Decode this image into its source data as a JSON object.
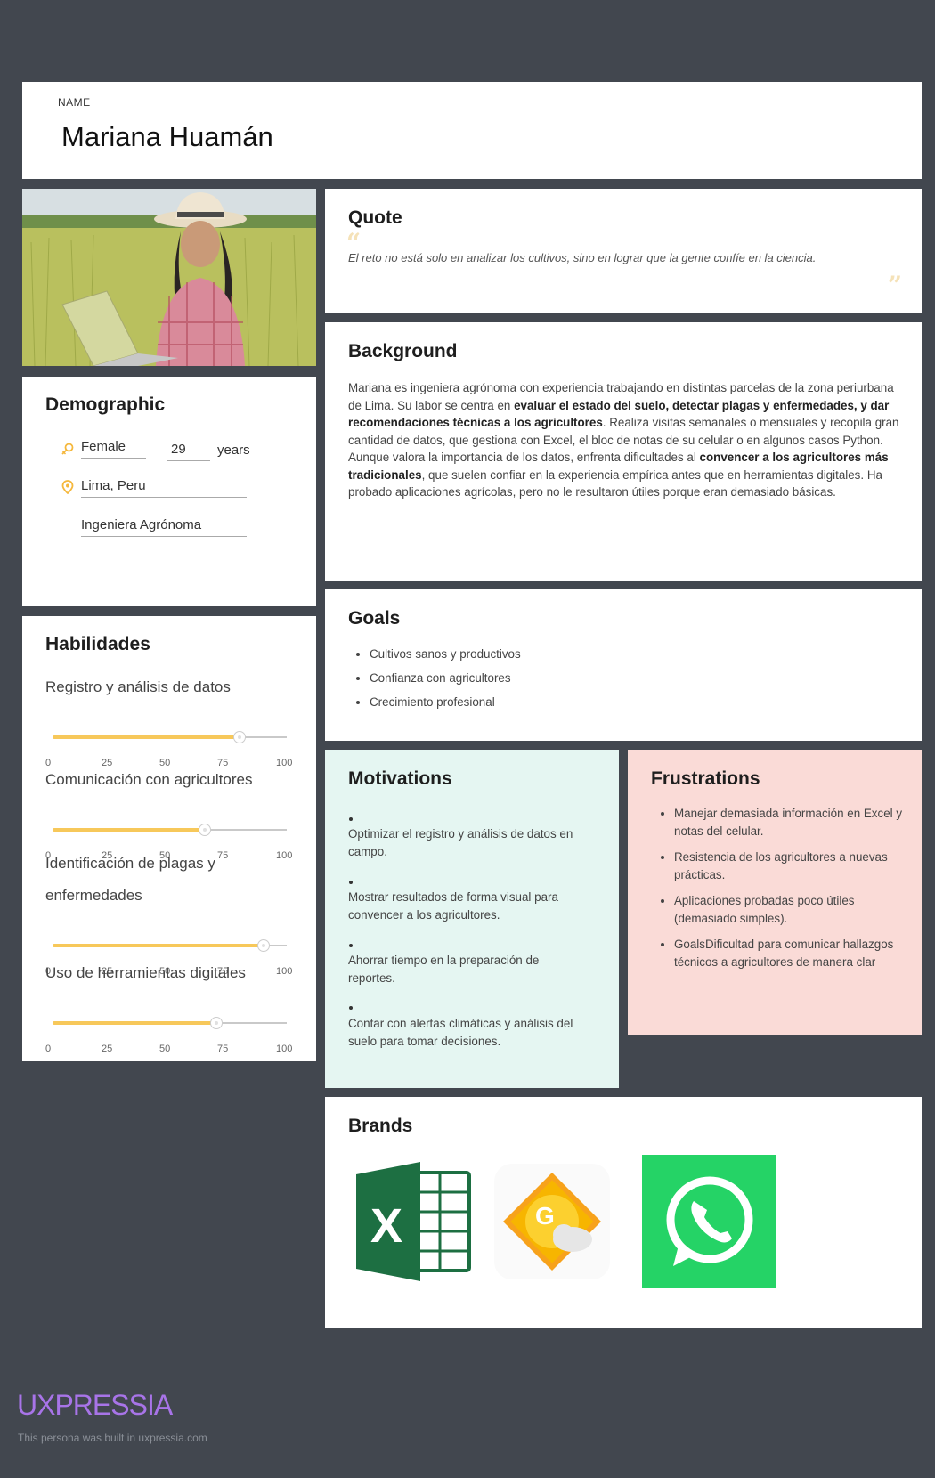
{
  "header": {
    "name_label": "NAME",
    "name": "Mariana Huamán"
  },
  "demographic": {
    "title": "Demographic",
    "gender": "Female",
    "age": "29",
    "age_unit": "years",
    "location": "Lima, Peru",
    "occupation": "Ingeniera Agrónoma"
  },
  "skills": {
    "title": "Habilidades",
    "ticks": [
      "0",
      "25",
      "50",
      "75",
      "100"
    ],
    "items": [
      {
        "label": "Registro y análisis de datos",
        "value": 80
      },
      {
        "label": "Comunicación con agricultores",
        "value": 65
      },
      {
        "label": "Identificación de plagas y enfermedades",
        "value": 90
      },
      {
        "label": "Uso de herramientas digitales",
        "value": 70
      }
    ]
  },
  "quote": {
    "title": "Quote",
    "text": "El reto no está solo en analizar los cultivos, sino en lograr que la gente confíe en la ciencia."
  },
  "background": {
    "title": "Background",
    "p1_a": "Mariana es ingeniera agrónoma con experiencia trabajando en distintas parcelas de la zona periurbana de Lima. Su labor se centra en ",
    "p1_b": "evaluar el estado del suelo, detectar plagas y enfermedades, y dar recomendaciones técnicas a los agricultores",
    "p1_c": ". Realiza visitas semanales o mensuales y recopila gran cantidad de datos, que gestiona con Excel, el bloc de notas de su celular o en algunos casos Python.",
    "p2_a": "Aunque valora la importancia de los datos, enfrenta dificultades al ",
    "p2_b": "convencer a los agricultores más tradicionales",
    "p2_c": ", que suelen confiar en la experiencia empírica antes que en herramientas digitales. Ha probado aplicaciones agrícolas, pero no le resultaron útiles porque eran demasiado básicas."
  },
  "goals": {
    "title": "Goals",
    "items": [
      "Cultivos sanos y productivos",
      "Confianza con agricultores",
      "Crecimiento profesional"
    ]
  },
  "motivations": {
    "title": "Motivations",
    "items": [
      "Optimizar el registro y análisis de datos en campo.",
      "Mostrar resultados de forma visual para convencer a los agricultores.",
      "Ahorrar tiempo en la preparación de reportes.",
      "Contar con alertas climáticas y análisis del suelo para tomar decisiones."
    ]
  },
  "frustrations": {
    "title": "Frustrations",
    "items": [
      "Manejar demasiada información en Excel y notas del celular.",
      "Resistencia de los agricultores a nuevas prácticas.",
      "Aplicaciones probadas poco útiles (demasiado simples).",
      "GoalsDificultad para comunicar hallazgos técnicos a agricultores de manera clar"
    ]
  },
  "brands": {
    "title": "Brands",
    "items": [
      {
        "icon": "excel-icon",
        "letter": "X",
        "color": "#1d6f42"
      },
      {
        "icon": "weather-icon",
        "letter": "G",
        "color": "#f7b500"
      },
      {
        "icon": "whatsapp-icon",
        "color": "#25d366"
      }
    ]
  },
  "footer": {
    "logo": "UXPRESSIA",
    "note": "This persona was built in uxpressia.com"
  },
  "colors": {
    "page_bg": "#42474f",
    "accent": "#f7c85a",
    "motivations_bg": "#e5f6f2",
    "frustrations_bg": "#fadbd7"
  }
}
